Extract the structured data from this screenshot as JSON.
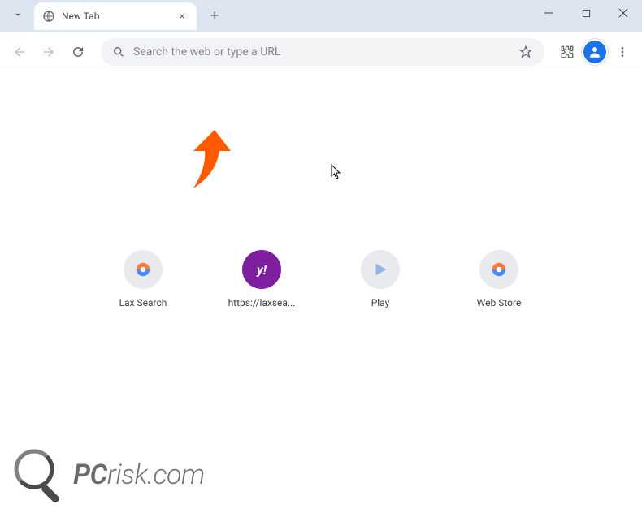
{
  "tab": {
    "title": "New Tab"
  },
  "omnibox": {
    "placeholder": "Search the web or type a URL"
  },
  "shortcuts": [
    {
      "label": "Lax Search",
      "icon": "globe-color"
    },
    {
      "label": "https://laxsea...",
      "icon": "yahoo"
    },
    {
      "label": "Play",
      "icon": "play-tri"
    },
    {
      "label": "Web Store",
      "icon": "globe-color"
    }
  ],
  "watermark": {
    "prefix": "PC",
    "suffix": "risk.com"
  }
}
